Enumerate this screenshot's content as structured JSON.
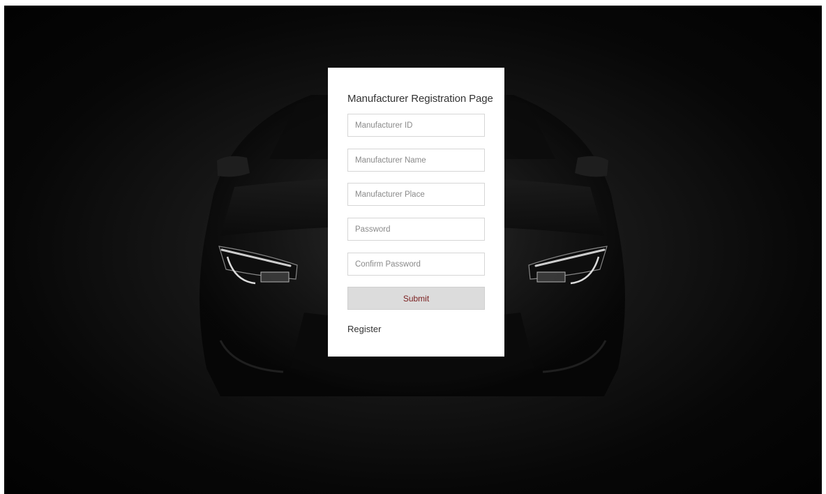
{
  "page": {
    "title": "Manufacturer Registration Page"
  },
  "form": {
    "fields": [
      {
        "name": "manufacturer-id",
        "placeholder": "Manufacturer ID",
        "value": ""
      },
      {
        "name": "manufacturer-name",
        "placeholder": "Manufacturer Name",
        "value": ""
      },
      {
        "name": "manufacturer-place",
        "placeholder": "Manufacturer Place",
        "value": ""
      },
      {
        "name": "password",
        "placeholder": "Password",
        "value": ""
      },
      {
        "name": "confirm-password",
        "placeholder": "Confirm Password",
        "value": ""
      }
    ],
    "submit_label": "Submit",
    "register_label": "Register"
  },
  "colors": {
    "background": "#0a0a0a",
    "card": "#ffffff",
    "submit_bg": "#dcdcdc",
    "submit_text": "#7a1e1e"
  }
}
